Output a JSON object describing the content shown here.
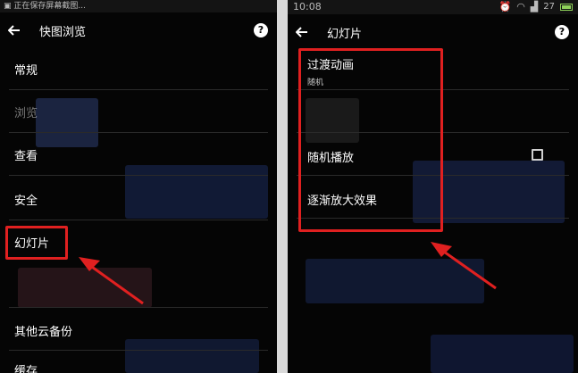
{
  "left": {
    "statusbar": {
      "text": "正在保存屏幕截图..."
    },
    "header": {
      "title": "快图浏览",
      "help": "?"
    },
    "items": [
      {
        "label": "常规"
      },
      {
        "label": "浏览"
      },
      {
        "label": "查看"
      },
      {
        "label": "安全"
      },
      {
        "label": "幻灯片"
      },
      {
        "label": "其他云备份"
      },
      {
        "label": "缓存"
      }
    ]
  },
  "right": {
    "statusbar": {
      "time": "10:08",
      "signal": "27"
    },
    "header": {
      "title": "幻灯片",
      "help": "?"
    },
    "items": [
      {
        "label": "过渡动画",
        "sub": "随机"
      },
      {
        "label": "随机播放"
      },
      {
        "label": "逐渐放大效果"
      }
    ]
  },
  "colors": {
    "highlight": "#e02020",
    "background": "#050505",
    "text": "#ffffff"
  }
}
